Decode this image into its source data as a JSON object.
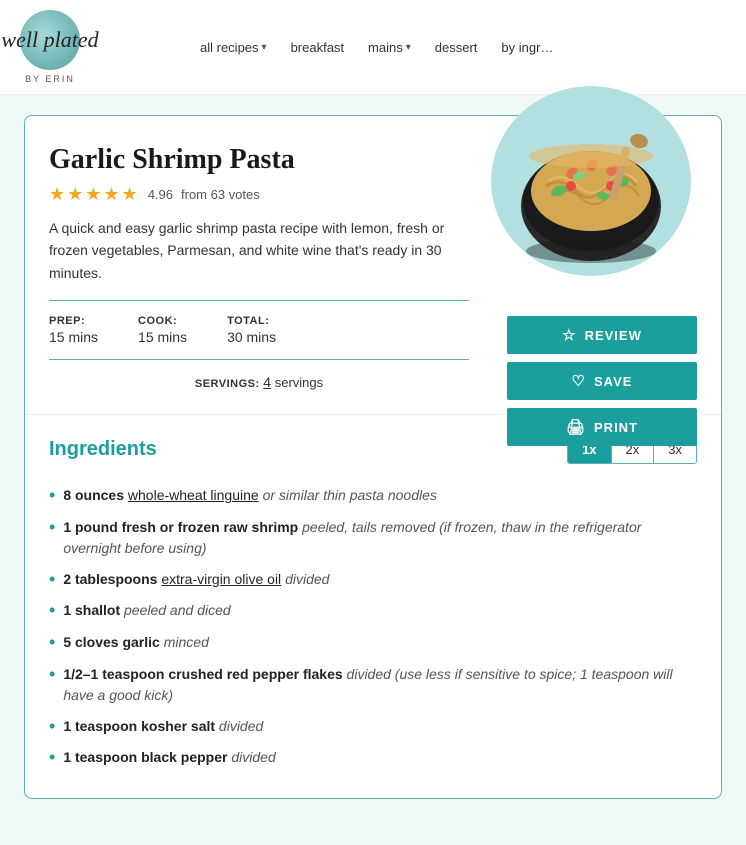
{
  "header": {
    "logo_text": "well plated",
    "logo_byline": "BY ERIN",
    "nav": [
      {
        "label": "all recipes",
        "has_chevron": true
      },
      {
        "label": "breakfast",
        "has_chevron": false
      },
      {
        "label": "mains",
        "has_chevron": true
      },
      {
        "label": "dessert",
        "has_chevron": false
      },
      {
        "label": "by ingr…",
        "has_chevron": false
      }
    ]
  },
  "recipe": {
    "title": "Garlic Shrimp Pasta",
    "rating_stars": "★★★★★",
    "rating_score": "4.96",
    "rating_votes": "from 63 votes",
    "description": "A quick and easy garlic shrimp pasta recipe with lemon, fresh or frozen vegetables, Parmesan, and white wine that's ready in 30 minutes.",
    "prep_label": "PREP:",
    "prep_value": "15 mins",
    "cook_label": "COOK:",
    "cook_value": "15 mins",
    "total_label": "TOTAL:",
    "total_value": "30 mins",
    "servings_label": "SERVINGS:",
    "servings_value": "4",
    "servings_unit": "servings",
    "buttons": [
      {
        "label": "REVIEW",
        "icon": "☆"
      },
      {
        "label": "SAVE",
        "icon": "♡"
      },
      {
        "label": "PRINT",
        "icon": "🖨"
      }
    ],
    "ingredients_title": "Ingredients",
    "multipliers": [
      "1x",
      "2x",
      "3x"
    ],
    "active_multiplier": "1x",
    "ingredients": [
      {
        "amount": "8 ounces",
        "item_linked": "whole-wheat linguine",
        "note": "or similar thin pasta noodles"
      },
      {
        "amount": "1 pound",
        "item": "fresh or frozen raw shrimp",
        "note": "peeled, tails removed (if frozen, thaw in the refrigerator overnight before using)"
      },
      {
        "amount": "2 tablespoons",
        "item_linked": "extra-virgin olive oil",
        "note": "divided"
      },
      {
        "amount": "1 shallot",
        "note": "peeled and diced"
      },
      {
        "amount": "5 cloves garlic",
        "note": "minced"
      },
      {
        "amount": "1/2–1 teaspoon",
        "item": "crushed red pepper flakes",
        "note": "divided (use less if sensitive to spice; 1 teaspoon will have a good kick)"
      },
      {
        "amount": "1 teaspoon kosher salt",
        "note": "divided"
      },
      {
        "amount": "1 teaspoon black pepper",
        "note": "divided"
      }
    ]
  }
}
